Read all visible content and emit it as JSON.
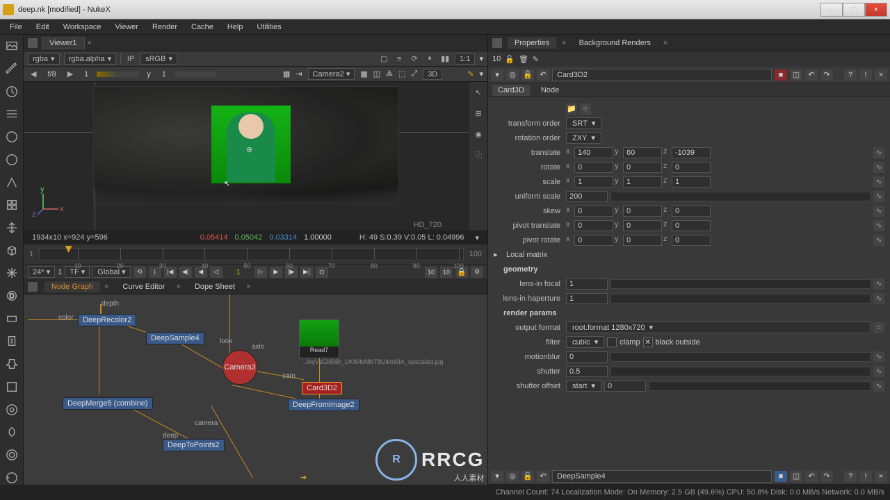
{
  "titlebar": {
    "title": "deep.nk [modified] - NukeX"
  },
  "menu": [
    "File",
    "Edit",
    "Workspace",
    "Viewer",
    "Render",
    "Cache",
    "Help",
    "Utilities"
  ],
  "viewer": {
    "tab": "Viewer1",
    "channel": "rgba",
    "alpha": "rgba.alpha",
    "ip": "IP",
    "colorspace": "sRGB",
    "zoom": "1:1",
    "fstop_l": "f/8",
    "fstop_r": "1",
    "y": "y",
    "yval": "1",
    "camera": "Camera2",
    "mode3d": "3D",
    "viewport_label": "HD_720"
  },
  "axis": {
    "x": "x",
    "y": "y",
    "z": "z"
  },
  "pixelinfo": {
    "res": "1934x10 x=924 y=596",
    "r": "0.05414",
    "g": "0.05042",
    "b": "0.03314",
    "a": "1.00000",
    "hsv": "H: 49 S:0.39 V:0.05 L: 0.04996"
  },
  "timeline": {
    "start": "1",
    "end": "100",
    "ticks": [
      "10",
      "20",
      "30",
      "40",
      "50",
      "60",
      "70",
      "80",
      "90",
      "100"
    ],
    "current": "1",
    "fps": "24*",
    "gain": "1",
    "tf": "TF",
    "global": "Global",
    "j10": "10",
    "j1": "1"
  },
  "ng": {
    "tabs": [
      "Node Graph",
      "Curve Editor",
      "Dope Sheet"
    ],
    "nodes": {
      "depth": "depth",
      "color": "color",
      "deeprecolor": "DeepRecolor2",
      "deepsample": "DeepSample4",
      "camera3": "Camera3",
      "read7": "Read7",
      "read7_file": "...IkyVaGk5lBI_UKf6ilkNfkT8UlkbI6IA_upscaled.jpg",
      "card3d2": "Card3D2",
      "deepfromimage": "DeepFromImage2",
      "deepmerge": "DeepMerge5 (combine)",
      "deeptopoints": "DeepToPoints2",
      "look": "look",
      "axis_lbl": "axis",
      "cam": "cam",
      "deep": "deep",
      "camera_lbl": "camera"
    }
  },
  "properties": {
    "count": "10",
    "tab1": "Properties",
    "tab2": "Background Renders",
    "node_name": "Card3D2",
    "subtabs": [
      "Card3D",
      "Node"
    ],
    "transform_order": {
      "label": "transform order",
      "value": "SRT"
    },
    "rotation_order": {
      "label": "rotation order",
      "value": "ZXY"
    },
    "translate": {
      "label": "translate",
      "x": "140",
      "y": "60",
      "z": "-1039"
    },
    "rotate": {
      "label": "rotate",
      "x": "0",
      "y": "0",
      "z": "0"
    },
    "scale": {
      "label": "scale",
      "x": "1",
      "y": "1",
      "z": "1"
    },
    "uniform_scale": {
      "label": "uniform scale",
      "value": "200"
    },
    "skew": {
      "label": "skew",
      "x": "0",
      "y": "0",
      "z": "0"
    },
    "pivot_translate": {
      "label": "pivot translate",
      "x": "0",
      "y": "0",
      "z": "0"
    },
    "pivot_rotate": {
      "label": "pivot rotate",
      "x": "0",
      "y": "0",
      "z": "0"
    },
    "local_matrix": "Local matrix",
    "geometry": "geometry",
    "lens_focal": {
      "label": "lens-in focal",
      "value": "1"
    },
    "lens_hap": {
      "label": "lens-in haperture",
      "value": "1"
    },
    "render_params": "render params",
    "output_format": {
      "label": "output format",
      "value": "root.format 1280x720"
    },
    "filter": {
      "label": "filter",
      "value": "cubic",
      "clamp": "clamp",
      "black": "black outside"
    },
    "motionblur": {
      "label": "motionblur",
      "value": "0"
    },
    "shutter": {
      "label": "shutter",
      "value": "0.5"
    },
    "shutter_offset": {
      "label": "shutter offset",
      "mode": "start",
      "value": "0"
    },
    "second_node": "DeepSample4"
  },
  "status": "Channel Count: 74 Localization Mode: On Memory: 2.5 GB (49.6%) CPU: 50.8% Disk: 0.0 MB/s Network: 0.0 MB/s",
  "logo": {
    "badge": "R",
    "text": "RRCG",
    "sub": "人人素材"
  },
  "icons": {
    "tri_down": "▾",
    "tri_right": "▸",
    "check": "✕",
    "x": "×",
    "lock": "🔒",
    "play": "▶",
    "pause": "⏸",
    "arrow": "➔"
  }
}
